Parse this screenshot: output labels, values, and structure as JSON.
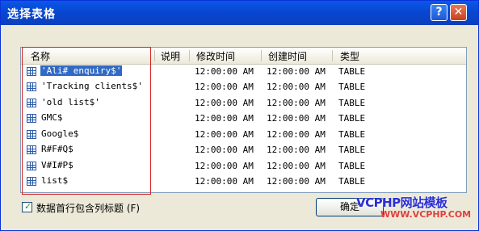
{
  "dialog": {
    "title": "选择表格",
    "help_glyph": "?",
    "close_glyph": "✕"
  },
  "columns": {
    "name": "名称",
    "description": "说明",
    "modified": "修改时间",
    "created": "创建时间",
    "type": "类型"
  },
  "rows": [
    {
      "name": "'Ali# enquiry$'",
      "modified": "12:00:00 AM",
      "created": "12:00:00 AM",
      "type": "TABLE"
    },
    {
      "name": "'Tracking clients$'",
      "modified": "12:00:00 AM",
      "created": "12:00:00 AM",
      "type": "TABLE"
    },
    {
      "name": "'old list$'",
      "modified": "12:00:00 AM",
      "created": "12:00:00 AM",
      "type": "TABLE"
    },
    {
      "name": "GMC$",
      "modified": "12:00:00 AM",
      "created": "12:00:00 AM",
      "type": "TABLE"
    },
    {
      "name": "Google$",
      "modified": "12:00:00 AM",
      "created": "12:00:00 AM",
      "type": "TABLE"
    },
    {
      "name": "R#F#Q$",
      "modified": "12:00:00 AM",
      "created": "12:00:00 AM",
      "type": "TABLE"
    },
    {
      "name": "V#I#P$",
      "modified": "12:00:00 AM",
      "created": "12:00:00 AM",
      "type": "TABLE"
    },
    {
      "name": "list$",
      "modified": "12:00:00 AM",
      "created": "12:00:00 AM",
      "type": "TABLE"
    }
  ],
  "footer": {
    "checkbox_label": "数据首行包含列标题 (F)",
    "checkbox_checked": true,
    "ok_label": "确定"
  },
  "watermark": {
    "line1": "VCPHP网站模板",
    "line2": "WWW.VCPHP.COM"
  },
  "colors": {
    "titlebar": "#0a58e8",
    "selection": "#316ac5",
    "highlight_box": "#d62020"
  }
}
